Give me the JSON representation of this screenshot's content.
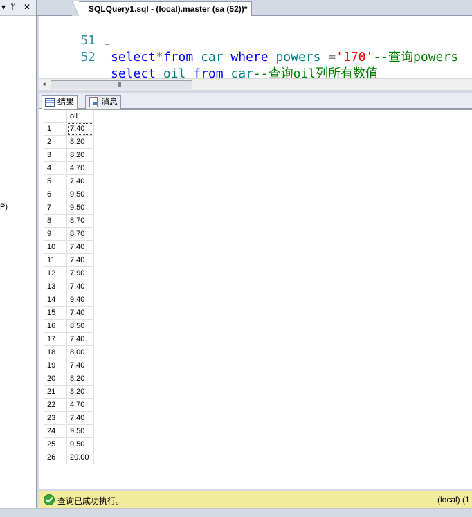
{
  "left_panel": {
    "titlebar_icons": [
      "dropdown-arrow-icon",
      "pin-icon",
      "close-icon"
    ],
    "titlebar_glyphs": [
      "▾",
      "ᛘ",
      "✕"
    ],
    "fragment_text": "P)"
  },
  "document_tab": {
    "title": "SQLQuery1.sql - (local).master (sa (52))*"
  },
  "editor": {
    "lines": [
      {
        "number": "51",
        "tokens": [
          {
            "t": "select",
            "c": "kw"
          },
          {
            "t": "*",
            "c": "op"
          },
          {
            "t": "from",
            "c": "kw"
          },
          {
            "t": " car ",
            "c": "id"
          },
          {
            "t": "where",
            "c": "kw"
          },
          {
            "t": " powers ",
            "c": "id"
          },
          {
            "t": "=",
            "c": "op"
          },
          {
            "t": "'170'",
            "c": "str"
          },
          {
            "t": "--查询powers",
            "c": "cm"
          }
        ]
      },
      {
        "number": "52",
        "tokens": [
          {
            "t": "select",
            "c": "kw"
          },
          {
            "t": " oil ",
            "c": "id"
          },
          {
            "t": "from",
            "c": "kw"
          },
          {
            "t": " car",
            "c": "id"
          },
          {
            "t": "--查询oil列所有数值",
            "c": "cm"
          }
        ]
      }
    ]
  },
  "scrollbar": {
    "grip": "III",
    "left_arrow": "◂"
  },
  "result_tabs": [
    {
      "label": "结果",
      "icon": "grid-icon"
    },
    {
      "label": "消息",
      "icon": "message-icon"
    }
  ],
  "results": {
    "columns": [
      "oil"
    ],
    "rows": [
      [
        "1",
        "7.40"
      ],
      [
        "2",
        "8.20"
      ],
      [
        "3",
        "8.20"
      ],
      [
        "4",
        "4.70"
      ],
      [
        "5",
        "7.40"
      ],
      [
        "6",
        "9.50"
      ],
      [
        "7",
        "9.50"
      ],
      [
        "8",
        "8.70"
      ],
      [
        "9",
        "8.70"
      ],
      [
        "10",
        "7.40"
      ],
      [
        "11",
        "7.40"
      ],
      [
        "12",
        "7.90"
      ],
      [
        "13",
        "7.40"
      ],
      [
        "14",
        "9.40"
      ],
      [
        "15",
        "7.40"
      ],
      [
        "16",
        "8.50"
      ],
      [
        "17",
        "7.40"
      ],
      [
        "18",
        "8.00"
      ],
      [
        "19",
        "7.40"
      ],
      [
        "20",
        "8.20"
      ],
      [
        "21",
        "8.20"
      ],
      [
        "22",
        "4.70"
      ],
      [
        "23",
        "7.40"
      ],
      [
        "24",
        "9.50"
      ],
      [
        "25",
        "9.50"
      ],
      [
        "26",
        "20.00"
      ]
    ]
  },
  "status_bar": {
    "message": "查询已成功执行。",
    "server": "(local) (1",
    "status_color": "#f2eb9c"
  }
}
